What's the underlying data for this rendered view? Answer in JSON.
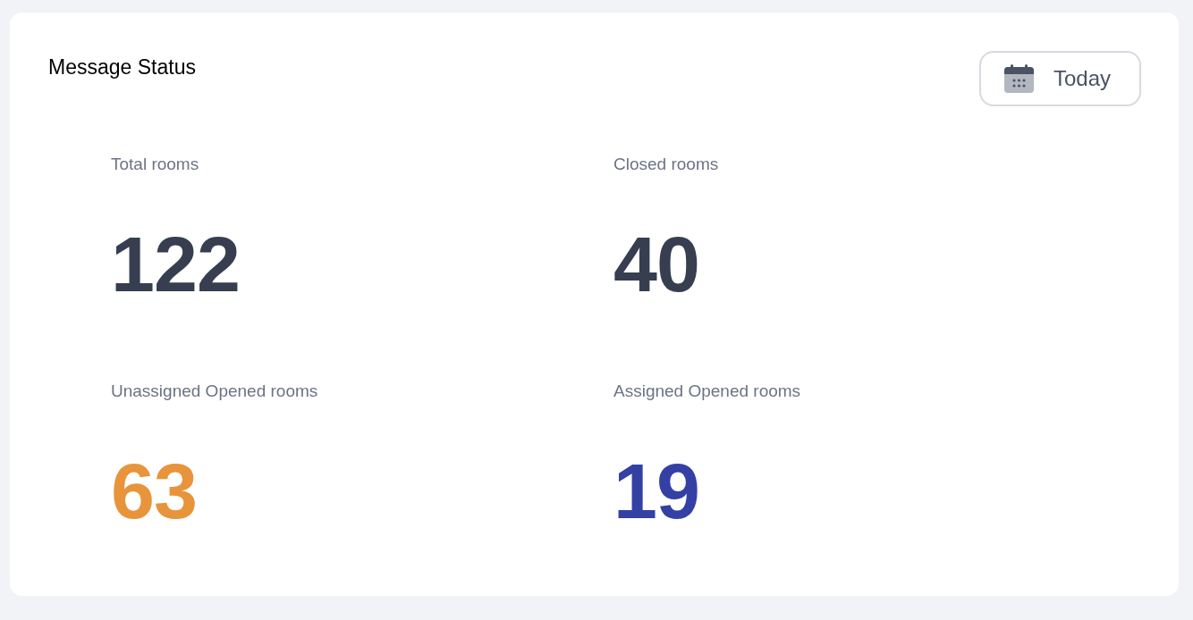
{
  "card": {
    "title": "Message Status",
    "date_button": {
      "label": "Today"
    },
    "stats": [
      {
        "label": "Total rooms",
        "value": "122",
        "color": "#363e50"
      },
      {
        "label": "Closed rooms",
        "value": "40",
        "color": "#363e50"
      },
      {
        "label": "Unassigned Opened rooms",
        "value": "63",
        "color": "#e8943a"
      },
      {
        "label": "Assigned Opened rooms",
        "value": "19",
        "color": "#3540a5"
      }
    ]
  }
}
